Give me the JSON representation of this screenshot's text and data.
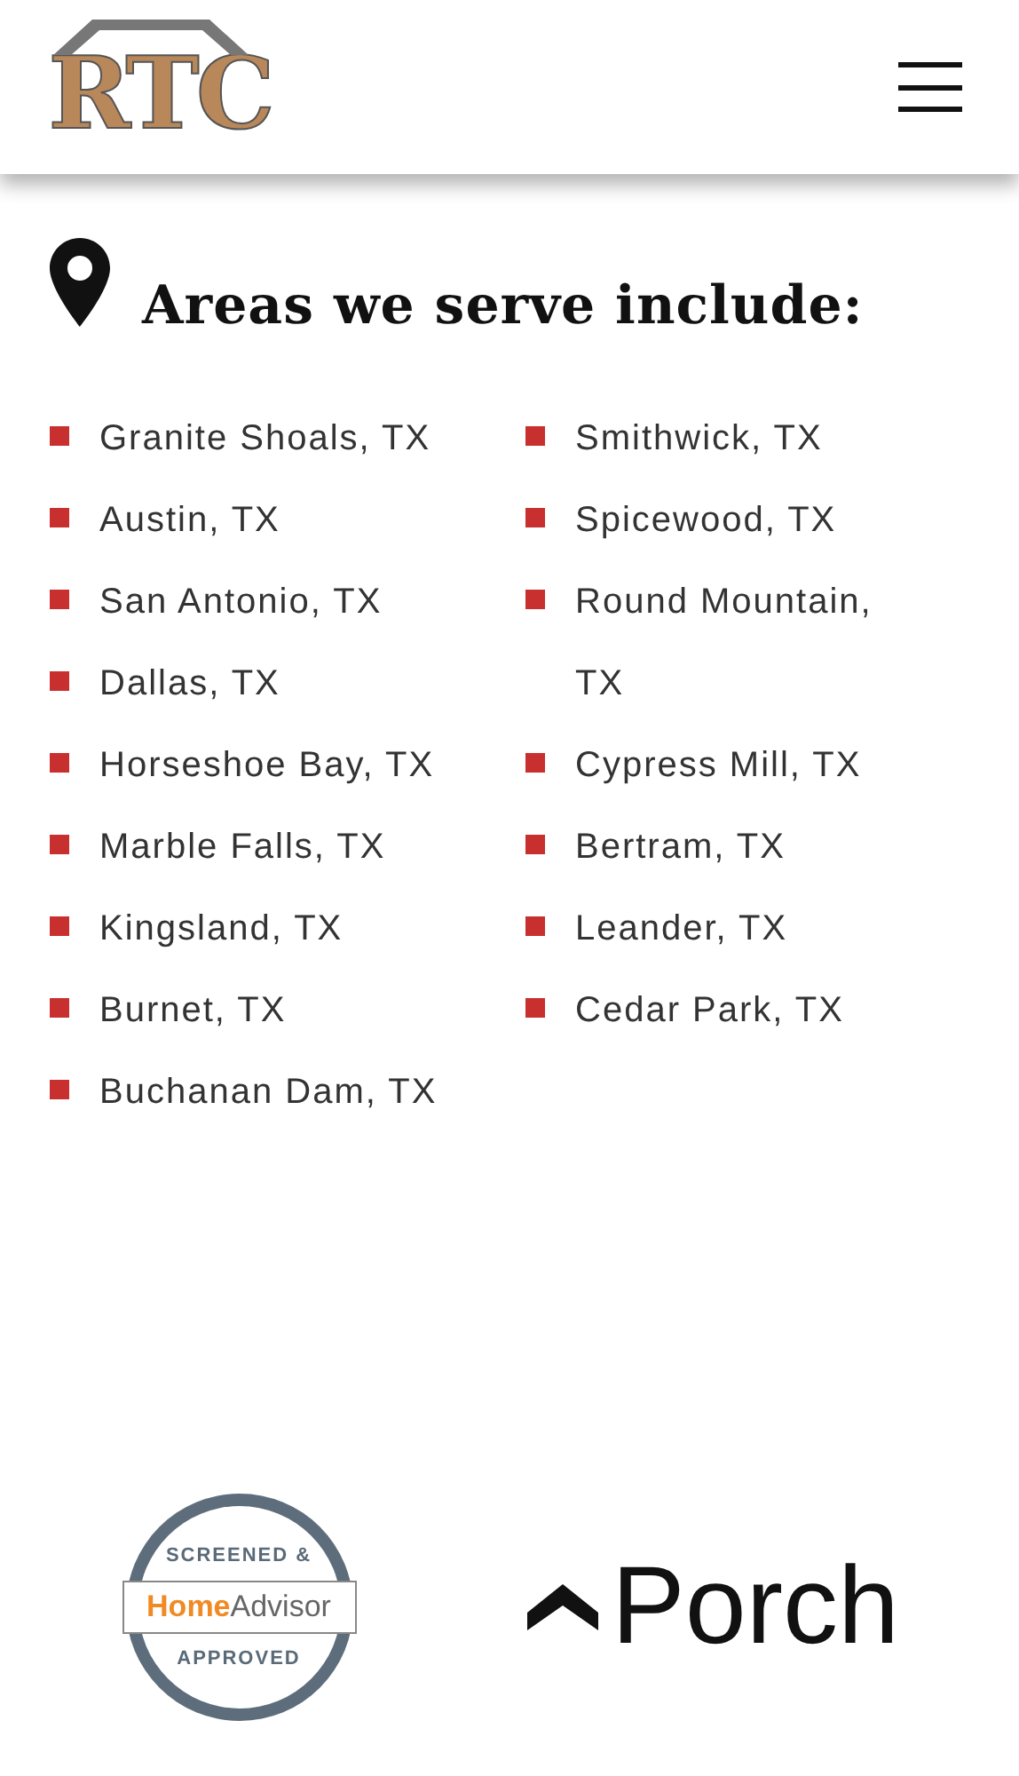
{
  "header": {
    "logo": {
      "letters": "RTC"
    }
  },
  "areas": {
    "heading": "Areas we serve include:",
    "columns": [
      [
        "Granite Shoals, TX",
        "Austin, TX",
        "San Antonio, TX",
        "Dallas, TX",
        "Horseshoe Bay, TX",
        "Marble Falls, TX",
        "Kingsland, TX",
        "Burnet, TX",
        "Buchanan Dam, TX"
      ],
      [
        "Smithwick, TX",
        "Spicewood, TX",
        "Round Mountain, TX",
        "Cypress Mill, TX",
        "Bertram, TX",
        "Leander, TX",
        "Cedar Park, TX"
      ]
    ]
  },
  "badges": {
    "homeadvisor": {
      "top": "SCREENED &",
      "brand_home": "Home",
      "brand_advisor": "Advisor",
      "bottom": "APPROVED"
    },
    "porch": {
      "name": "Porch"
    }
  }
}
